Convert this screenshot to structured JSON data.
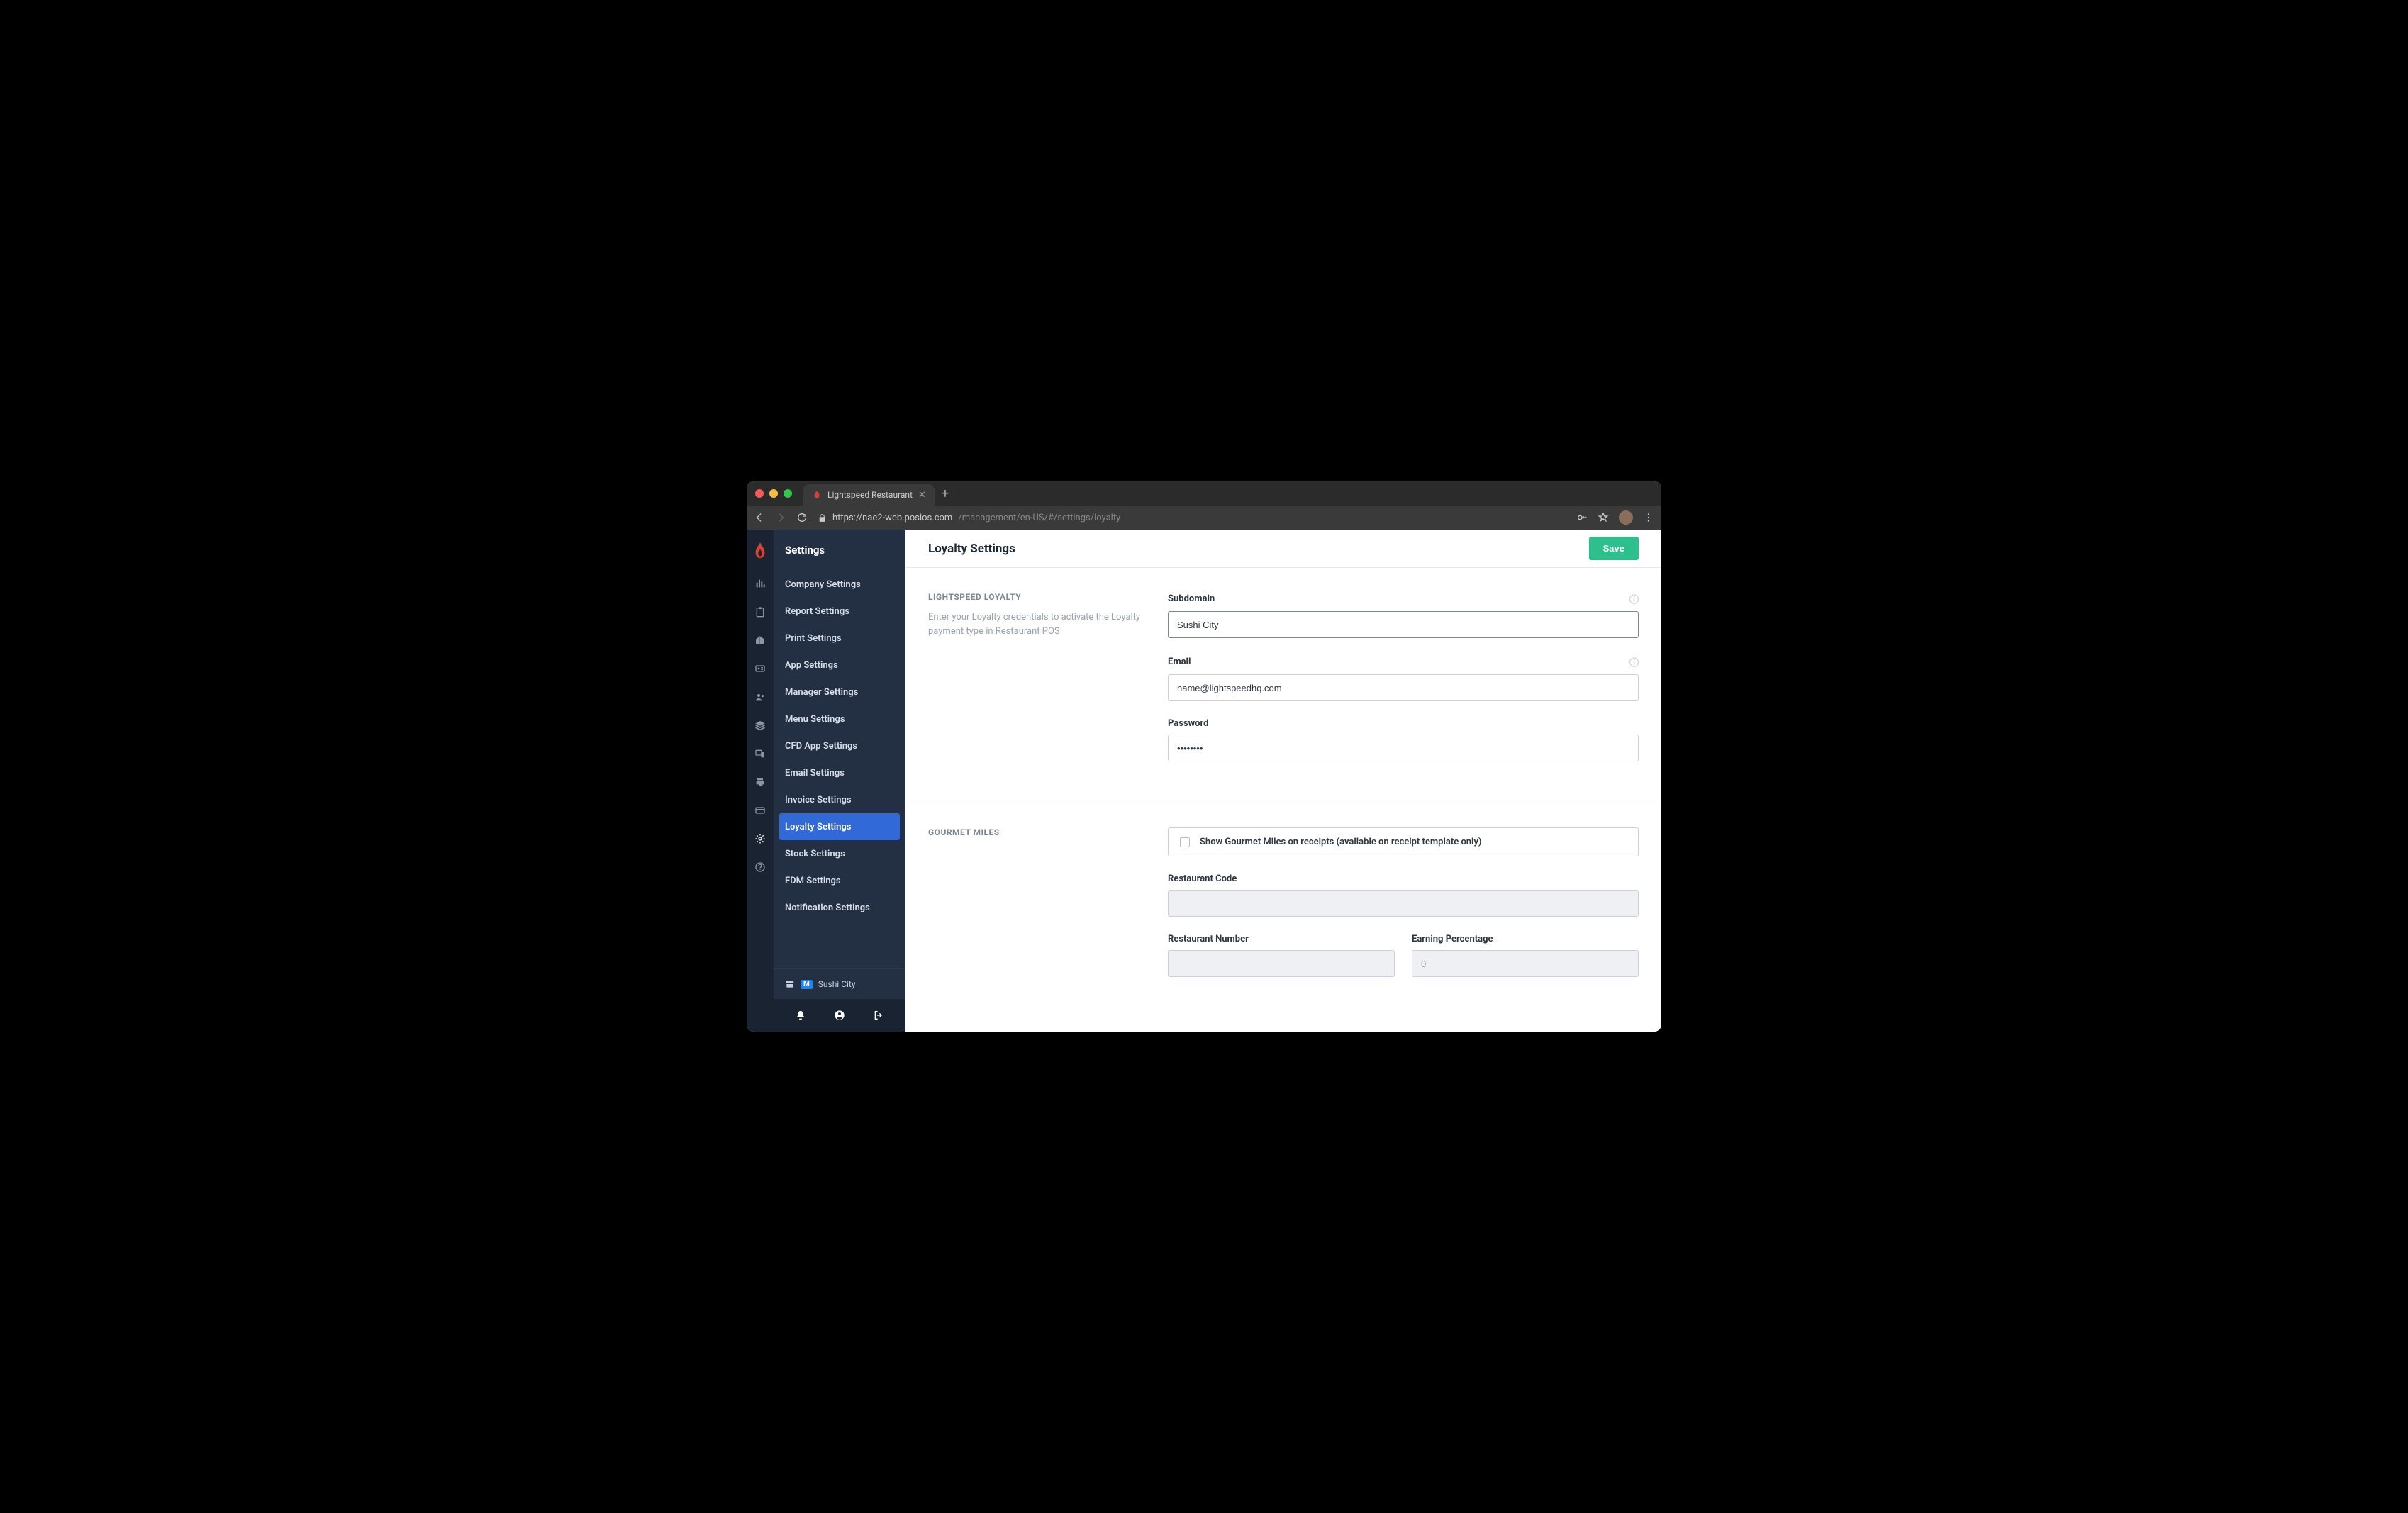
{
  "browser": {
    "tab_title": "Lightspeed Restaurant",
    "url_host": "https://nae2-web.posios.com",
    "url_path": "/management/en-US/#/settings/loyalty"
  },
  "sidebar": {
    "title": "Settings",
    "items": [
      {
        "label": "Company Settings",
        "active": false
      },
      {
        "label": "Report Settings",
        "active": false
      },
      {
        "label": "Print Settings",
        "active": false
      },
      {
        "label": "App Settings",
        "active": false
      },
      {
        "label": "Manager Settings",
        "active": false
      },
      {
        "label": "Menu Settings",
        "active": false
      },
      {
        "label": "CFD App Settings",
        "active": false
      },
      {
        "label": "Email Settings",
        "active": false
      },
      {
        "label": "Invoice Settings",
        "active": false
      },
      {
        "label": "Loyalty Settings",
        "active": true
      },
      {
        "label": "Stock Settings",
        "active": false
      },
      {
        "label": "FDM Settings",
        "active": false
      },
      {
        "label": "Notification Settings",
        "active": false
      }
    ],
    "store_badge": "M",
    "store_name": "Sushi City"
  },
  "page": {
    "title": "Loyalty Settings",
    "save_label": "Save"
  },
  "loyalty": {
    "section_title": "LIGHTSPEED LOYALTY",
    "section_desc": "Enter your Loyalty credentials to activate the Loyalty payment type in Restaurant POS",
    "subdomain_label": "Subdomain",
    "subdomain_value": "Sushi City",
    "email_label": "Email",
    "email_value": "name@lightspeedhq.com",
    "password_label": "Password",
    "password_value": "••••••••"
  },
  "gourmet": {
    "section_title": "GOURMET MILES",
    "checkbox_label": "Show Gourmet Miles on receipts (available on receipt template only)",
    "code_label": "Restaurant Code",
    "code_value": "",
    "number_label": "Restaurant Number",
    "number_value": "",
    "percent_label": "Earning Percentage",
    "percent_value": "0"
  }
}
